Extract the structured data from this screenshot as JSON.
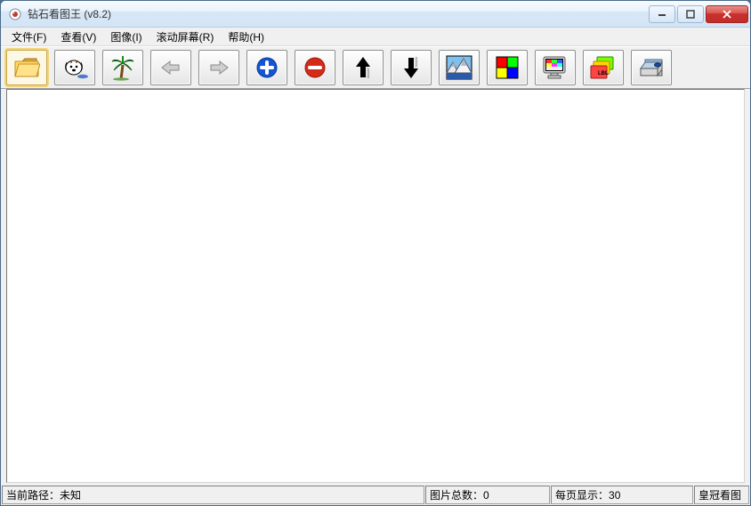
{
  "window": {
    "title": "钻石看图王 (v8.2)"
  },
  "menu": {
    "file": "文件(F)",
    "view": "查看(V)",
    "image": "图像(I)",
    "scroll": "滚动屏幕(R)",
    "help": "帮助(H)"
  },
  "toolbar": {
    "open_folder": "open-folder",
    "search": "search-dog",
    "tree": "palm-tree",
    "prev": "previous",
    "next": "next",
    "zoom_in": "zoom-in-plus",
    "zoom_out": "zoom-out-minus",
    "move_up": "arrow-up",
    "move_down": "arrow-down",
    "scenery": "scenery-picture",
    "colors": "color-squares",
    "monitor": "monitor-colors",
    "labels": "labels",
    "scanner": "scanner"
  },
  "status": {
    "path_label": "当前路径：",
    "path_value": "未知",
    "count_label": "图片总数：",
    "count_value": "0",
    "perpage_label": "每页显示：",
    "perpage_value": "30",
    "brand": "皇冠看图"
  }
}
